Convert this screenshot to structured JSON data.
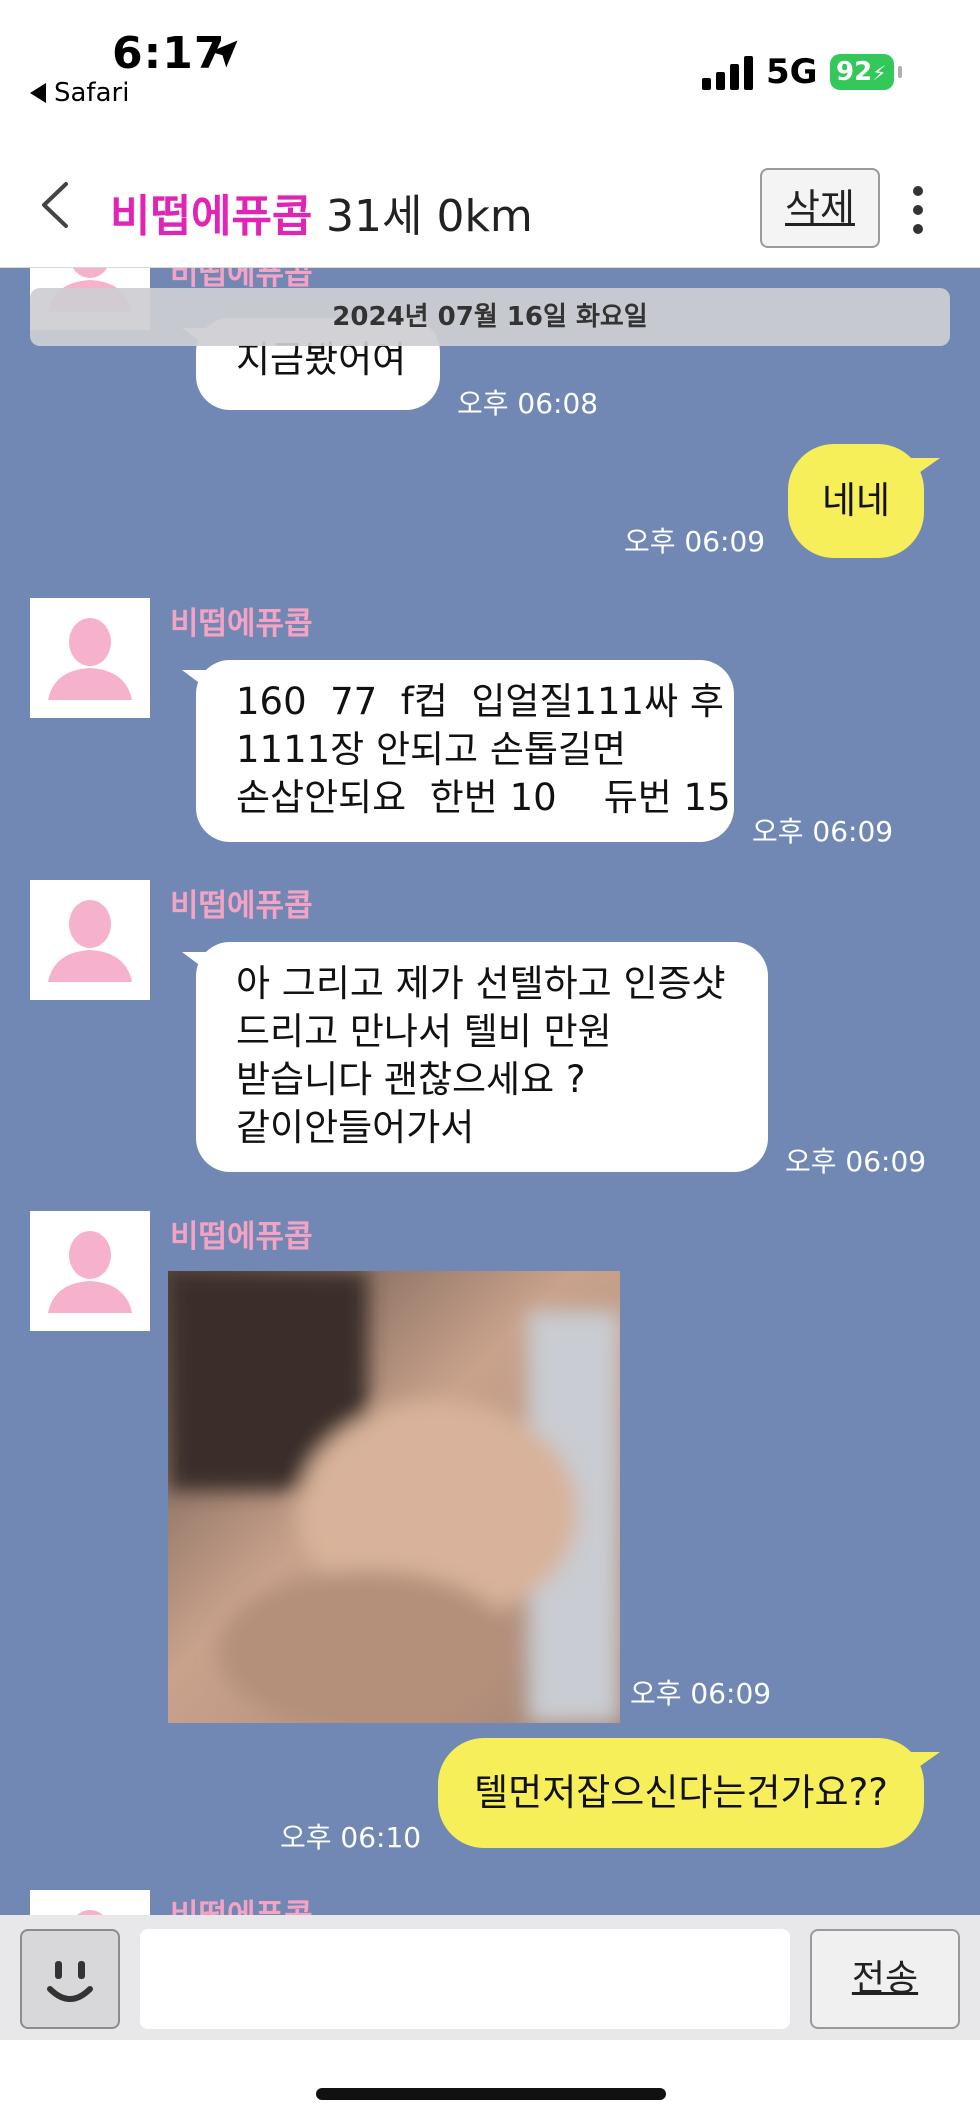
{
  "status_bar": {
    "time": "6:17",
    "back_app": "Safari",
    "network": "5G",
    "battery": "92"
  },
  "header": {
    "name": "비떱에퓨콥",
    "meta": "31세 0km",
    "delete_label": "삭제",
    "icons": {
      "back": "chevron-left-icon",
      "more": "more-vertical-icon"
    }
  },
  "chat": {
    "date_divider": "2024년 07월 16일 화요일",
    "messages": [
      {
        "side": "in",
        "sender": "비떱에퓨콥",
        "lines": [
          "지금봤어여"
        ],
        "time": "오후 06:08"
      },
      {
        "side": "out",
        "lines": [
          "네네"
        ],
        "time": "오후 06:09"
      },
      {
        "side": "in",
        "sender": "비떱에퓨콥",
        "lines": [
          "160  77  f컵  입얼질111싸 후",
          "1111장 안되고 손톱길면",
          "손삽안되요  한번 10    듀번 15"
        ],
        "time": "오후 06:09"
      },
      {
        "side": "in",
        "sender": "비떱에퓨콥",
        "lines": [
          "아 그리고 제가 선텔하고 인증샷",
          "드리고 만나서 텔비 만원",
          "받습니다 괜찮으세요 ?",
          "같이안들어가서"
        ],
        "time": "오후 06:09"
      },
      {
        "side": "in",
        "sender": "비떱에퓨콥",
        "type": "photo",
        "time": "오후 06:09"
      },
      {
        "side": "out",
        "lines": [
          "텔먼저잡으신다는건가요??"
        ],
        "time": "오후 06:10"
      },
      {
        "side": "in",
        "sender": "비떱에퓨콥"
      }
    ]
  },
  "input_bar": {
    "placeholder": "",
    "send_label": "전송",
    "icons": {
      "emoji": "smiley-icon"
    }
  },
  "colors": {
    "chat_background": "#7088b3",
    "incoming_bubble": "#ffffff",
    "outgoing_bubble": "#f7ef5a",
    "sender_name": "#f5a3c4",
    "header_name": "#e024b6"
  }
}
